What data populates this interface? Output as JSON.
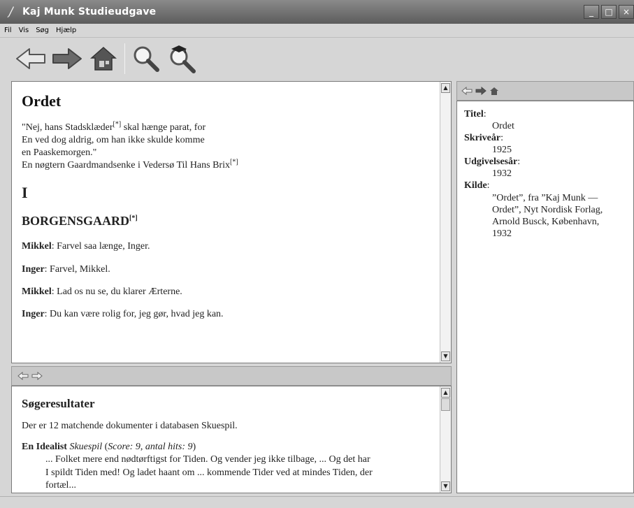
{
  "window": {
    "title": "Kaj Munk Studieudgave",
    "controls": [
      "_",
      "□",
      "×"
    ]
  },
  "menu": [
    "Fil",
    "Vis",
    "Søg",
    "Hjælp"
  ],
  "toolbar": {
    "icons": [
      "back-arrow-icon",
      "forward-arrow-icon",
      "home-icon",
      "search-magnifier-icon",
      "advanced-search-icon"
    ]
  },
  "document": {
    "title": "Ordet",
    "epigraph_line1_a": "\"Nej, hans Stadsklæder",
    "epigraph_line1_sup": "[*]",
    "epigraph_line1_b": " skal hænge parat, for",
    "epigraph_line2": "En ved dog aldrig, om han ikke skulde komme",
    "epigraph_line3": "en Paaskemorgen.\"",
    "dedication": "En nøgtern Gaardmandsenke i Vedersø Til Hans Brix",
    "dedication_sup": "[*]",
    "act": "I",
    "scene": "BORGENSGAARD",
    "scene_sup": "[*]",
    "lines": [
      {
        "speaker": "Mikkel",
        "text": ": Farvel saa længe, Inger."
      },
      {
        "speaker": "Inger",
        "text": ": Farvel, Mikkel."
      },
      {
        "speaker": "Mikkel",
        "text": ": Lad os nu se, du klarer Ærterne."
      },
      {
        "speaker": "Inger",
        "text": ": Du kan være rolig for, jeg gør, hvad jeg kan."
      }
    ]
  },
  "search": {
    "title": "Søgeresultater",
    "summary": "Der er 12 matchende dokumenter i databasen Skuespil.",
    "result": {
      "name": "En Idealist",
      "genre": "Skuespil",
      "score_open": " (",
      "score_label": "Score: 9",
      "sep": ", ",
      "hits_label": "antal hits: 9",
      "score_close": ")",
      "snippet_line1": "... Folket mere end nødtørftigst for Tiden. Og vender jeg ikke tilbage, ... Og det har",
      "snippet_line2": "I spildt Tiden med! Og ladet haant om ... kommende Tider ved at mindes Tiden, der",
      "snippet_line3": "fortæl..."
    }
  },
  "metadata": {
    "titel_label": "Titel",
    "titel_value": "Ordet",
    "skriveaar_label": "Skriveår",
    "skriveaar_value": "1925",
    "udgivelse_label": "Udgivelsesår",
    "udgivelse_value": "1932",
    "kilde_label": "Kilde",
    "kilde_line1": "”Ordet”, fra ”Kaj Munk —",
    "kilde_line2": "Ordet”, Nyt Nordisk Forlag,",
    "kilde_line3": "Arnold Busck, København,",
    "kilde_line4": "1932"
  }
}
